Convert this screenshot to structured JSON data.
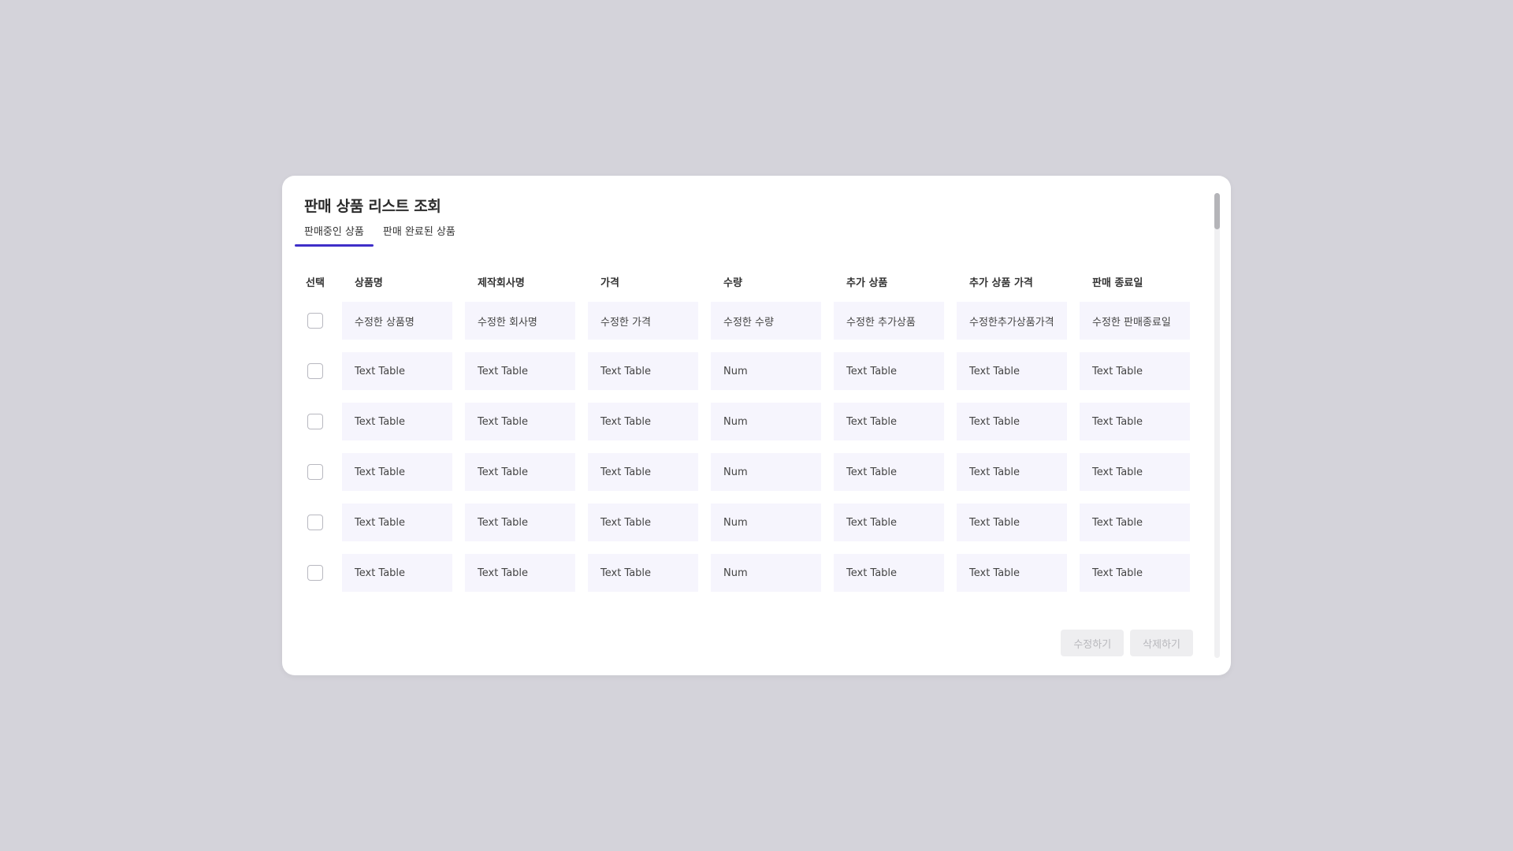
{
  "modal": {
    "title": "판매 상품 리스트 조회"
  },
  "tabs": [
    {
      "label": "판매중인 상품",
      "active": true
    },
    {
      "label": "판매 완료된 상품",
      "active": false
    }
  ],
  "table": {
    "select_header": "선택",
    "columns": [
      "상품명",
      "제작회사명",
      "가격",
      "수량",
      "추가 상품",
      "추가 상품 가격",
      "판매 종료일"
    ],
    "rows": [
      [
        "수정한 상품명",
        "수정한 회사명",
        "수정한 가격",
        "수정한 수량",
        "수정한 추가상품",
        "수정한추가상품가격",
        "수정한 판매종료일"
      ],
      [
        "Text Table",
        "Text Table",
        "Text Table",
        "Num",
        "Text Table",
        "Text Table",
        "Text Table"
      ],
      [
        "Text Table",
        "Text Table",
        "Text Table",
        "Num",
        "Text Table",
        "Text Table",
        "Text Table"
      ],
      [
        "Text Table",
        "Text Table",
        "Text Table",
        "Num",
        "Text Table",
        "Text Table",
        "Text Table"
      ],
      [
        "Text Table",
        "Text Table",
        "Text Table",
        "Num",
        "Text Table",
        "Text Table",
        "Text Table"
      ],
      [
        "Text Table",
        "Text Table",
        "Text Table",
        "Num",
        "Text Table",
        "Text Table",
        "Text Table"
      ]
    ]
  },
  "actions": {
    "edit_label": "수정하기",
    "delete_label": "삭제하기"
  },
  "colors": {
    "accent": "#3f2fc8",
    "cell_bg": "#f6f5fd",
    "backdrop": "#d4d3da"
  }
}
